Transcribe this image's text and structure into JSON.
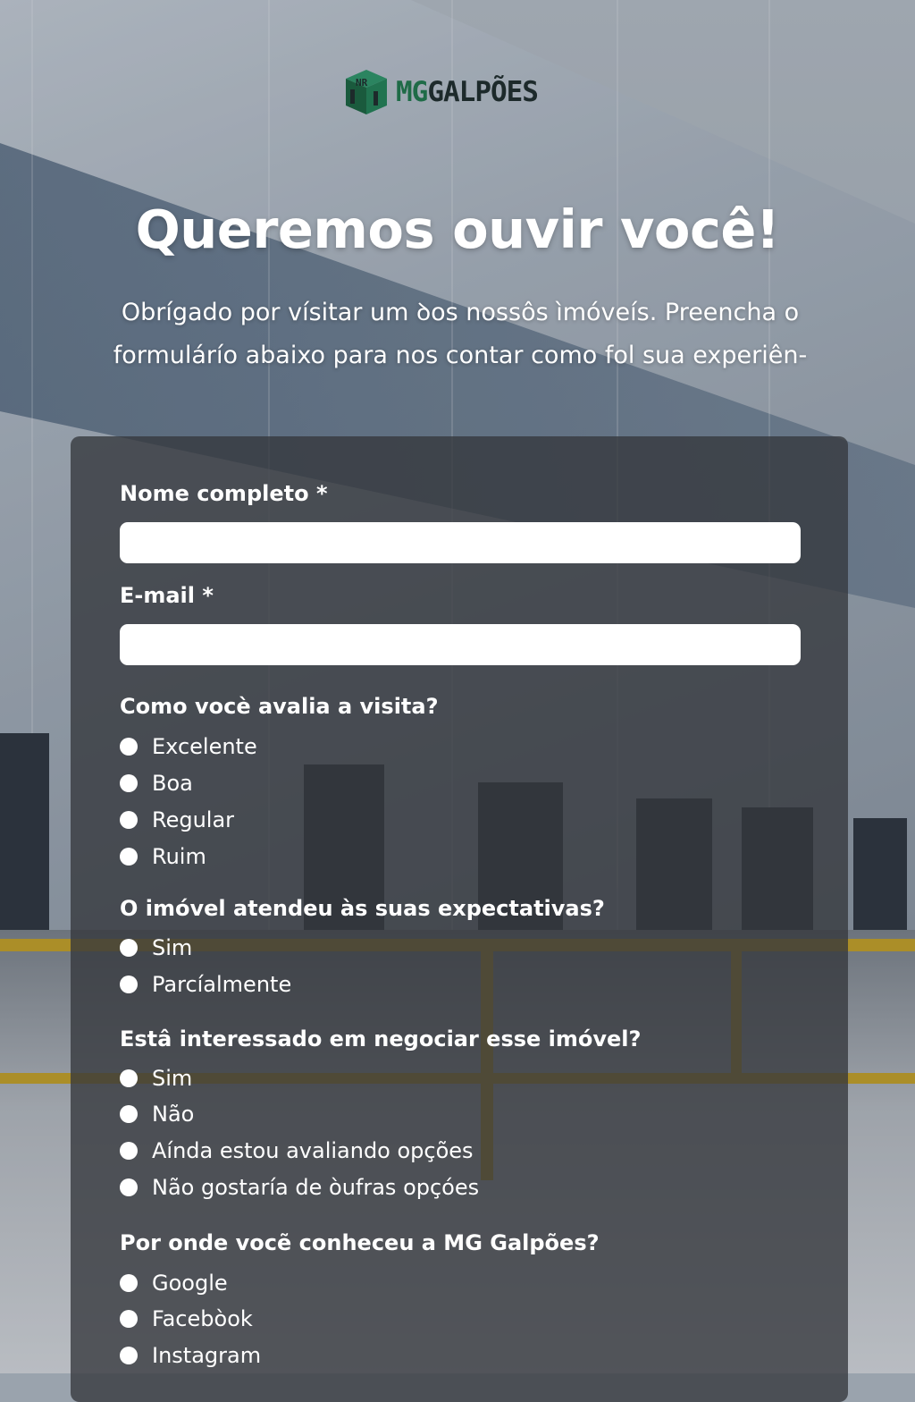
{
  "brand": {
    "mg": "MG",
    "galpoes": "GALPÕES",
    "badge": "NR"
  },
  "headline": "Queremos ouvir você!",
  "intro": "Obrígado por vísitar um ꝺos nossôs ìmóveís. Preencha o formulárío abaixo para nos contar como fol sua experiên-",
  "form": {
    "name_label": "Nome completo *",
    "name_value": "",
    "email_label": "E-mail *",
    "email_value": "",
    "questions": [
      {
        "label": "Como vocè avalia a visita?",
        "options": [
          "Excelente",
          "Boa",
          "Regular",
          "Ruim"
        ]
      },
      {
        "label": "O imóvel atendeu às suas expectativas?",
        "options": [
          "Sim",
          "Parcíalmente"
        ]
      },
      {
        "label": "Estâ interessado em negociar esse imóvel?",
        "options": [
          "Sim",
          "Não",
          "Aínda estou avaliando opções",
          "Não gostaría de òufras opçóes"
        ]
      },
      {
        "label": "Por onde vocẽ conheceu a MG Galpões?",
        "options": [
          "Google",
          "Facebòok",
          "Instagram"
        ]
      }
    ]
  },
  "colors": {
    "brand_green": "#1f6b47",
    "card_bg": "#34373c",
    "radio": "#ffffff"
  }
}
